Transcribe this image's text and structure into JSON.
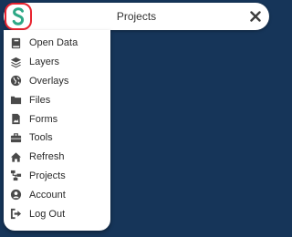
{
  "header": {
    "title": "Projects"
  },
  "menu": {
    "items": [
      {
        "label": "Open Data",
        "icon": "book-icon"
      },
      {
        "label": "Layers",
        "icon": "layers-icon"
      },
      {
        "label": "Overlays",
        "icon": "globe-icon"
      },
      {
        "label": "Files",
        "icon": "folder-icon"
      },
      {
        "label": "Forms",
        "icon": "form-icon"
      },
      {
        "label": "Tools",
        "icon": "toolbox-icon"
      },
      {
        "label": "Refresh",
        "icon": "home-icon"
      },
      {
        "label": "Projects",
        "icon": "sitemap-icon"
      },
      {
        "label": "Account",
        "icon": "user-circle-icon"
      },
      {
        "label": "Log Out",
        "icon": "sign-out-icon"
      }
    ]
  },
  "colors": {
    "background": "#163559",
    "logo": "#2ea886",
    "logo_ring": "#e8232f",
    "icon": "#4a4a4a"
  }
}
